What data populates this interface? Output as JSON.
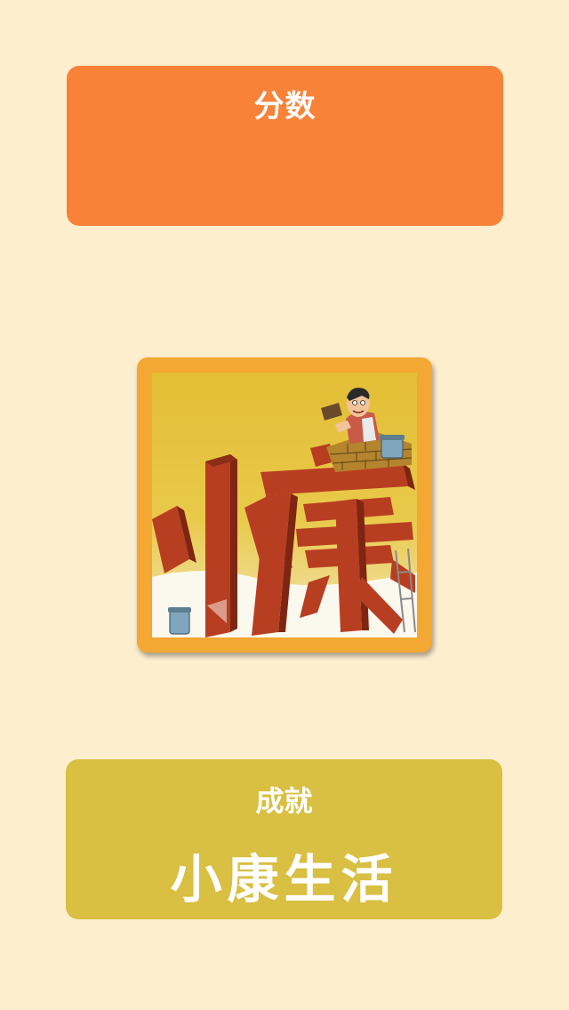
{
  "score_card": {
    "title": "分数",
    "value": "",
    "color": "#F78238"
  },
  "illustration": {
    "icon": "bricklayer-xiaokang-illustration",
    "text": "小康",
    "frame_color": "#F2A832"
  },
  "achievement_card": {
    "title": "成就",
    "value": "小康生活",
    "color": "#D9BF42"
  },
  "colors": {
    "background": "#FDEECE",
    "text": "#FFFFFF"
  }
}
